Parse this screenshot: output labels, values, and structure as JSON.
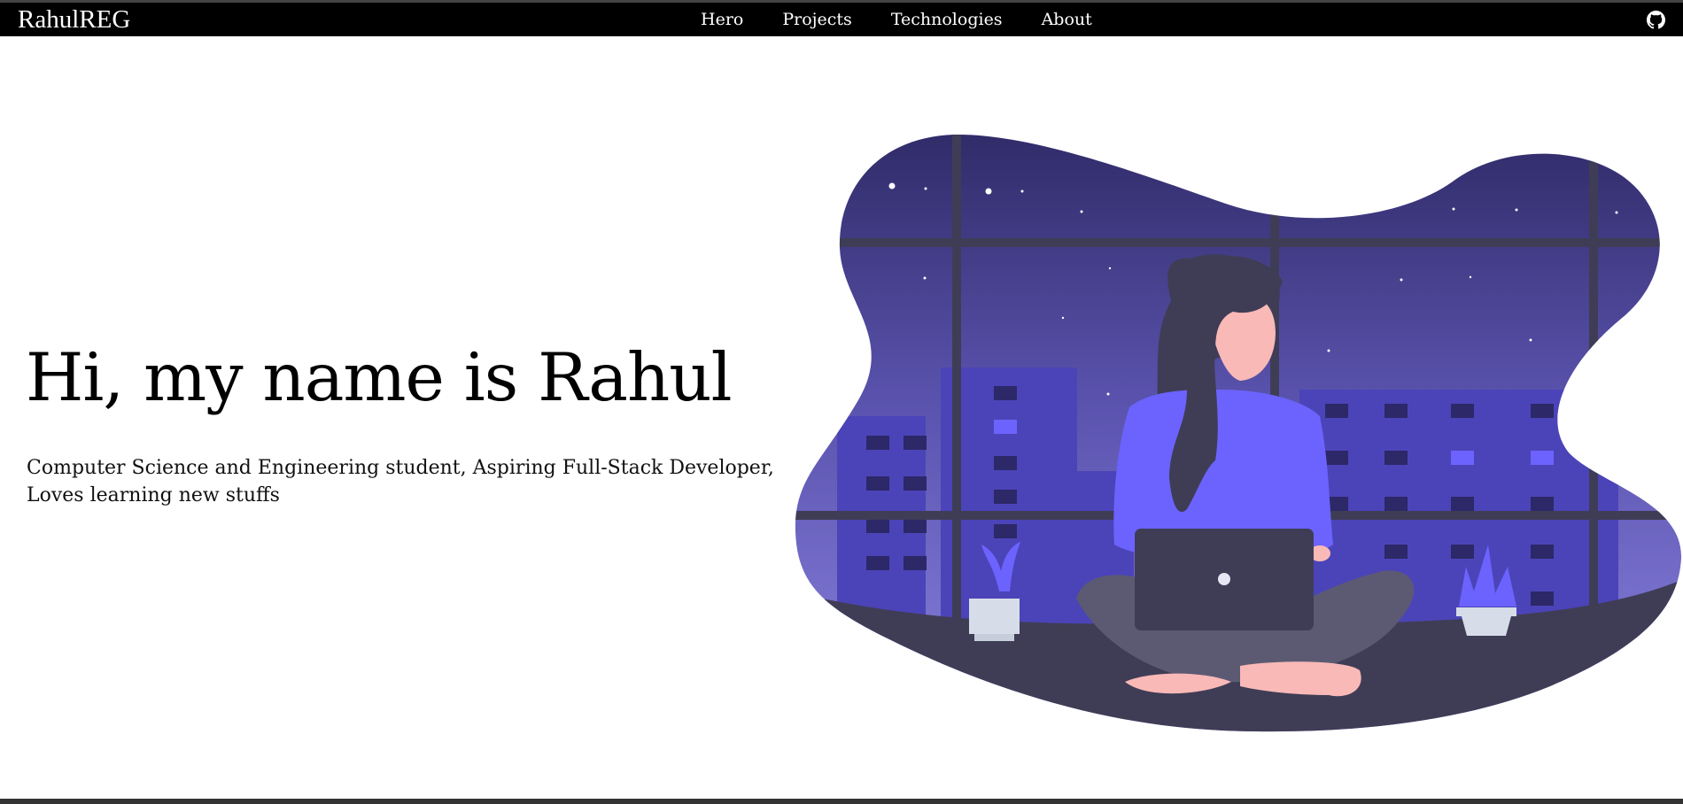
{
  "navbar": {
    "brand": "RahulREG",
    "links": [
      "Hero",
      "Projects",
      "Technologies",
      "About"
    ],
    "github_icon": "github-icon"
  },
  "hero": {
    "title": "Hi, my name is Rahul",
    "subtitle_line1": "Computer Science and Engineering student, Aspiring Full-Stack Developer,",
    "subtitle_line2": "Loves learning new stuffs"
  },
  "colors": {
    "navbar_bg": "#000000",
    "accent_purple": "#6c63ff",
    "night_sky": "#36306a",
    "building": "#4b44b8",
    "ground": "#3f3d56"
  }
}
